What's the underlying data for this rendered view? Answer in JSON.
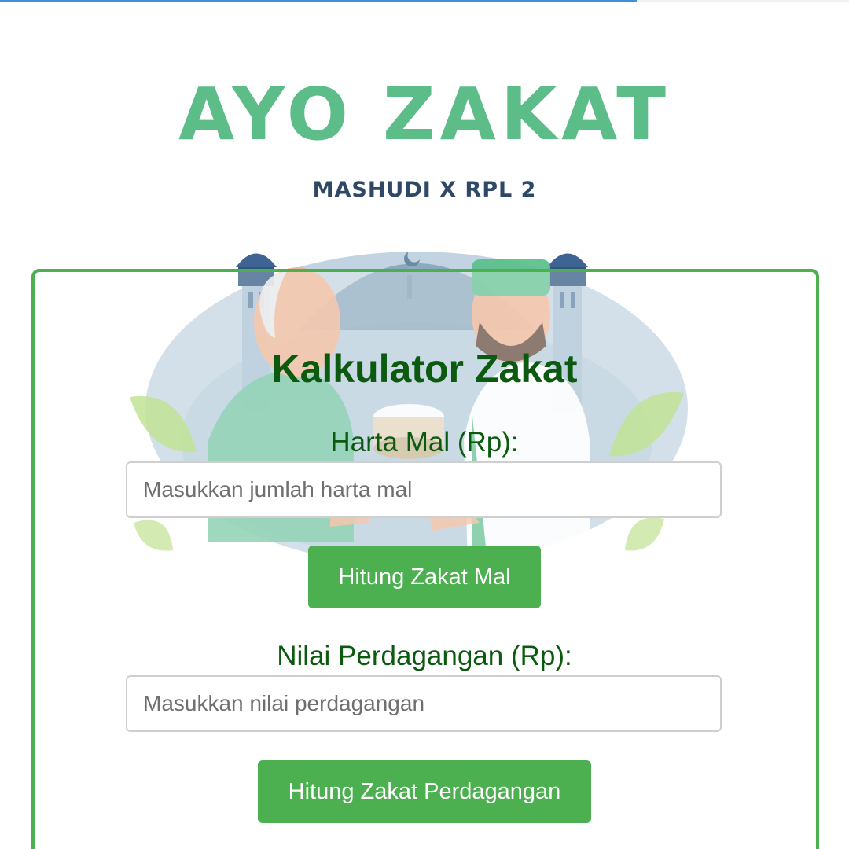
{
  "banner": {
    "title": "AYO ZAKAT",
    "subtitle": "MASHUDI X RPL 2"
  },
  "page_load_progress": 0.75,
  "colors": {
    "accent": "#4caf50",
    "heading": "#0b5a10",
    "banner_title": "#5dbd88",
    "banner_subtitle": "#2f4868",
    "progress": "#3f8fd8"
  },
  "calculator": {
    "title": "Kalkulator Zakat",
    "harta_mal": {
      "label": "Harta Mal (Rp):",
      "placeholder": "Masukkan jumlah harta mal",
      "value": "",
      "button_label": "Hitung Zakat Mal"
    },
    "perdagangan": {
      "label": "Nilai Perdagangan (Rp):",
      "placeholder": "Masukkan nilai perdagangan",
      "value": "",
      "button_label": "Hitung Zakat Perdagangan"
    }
  }
}
